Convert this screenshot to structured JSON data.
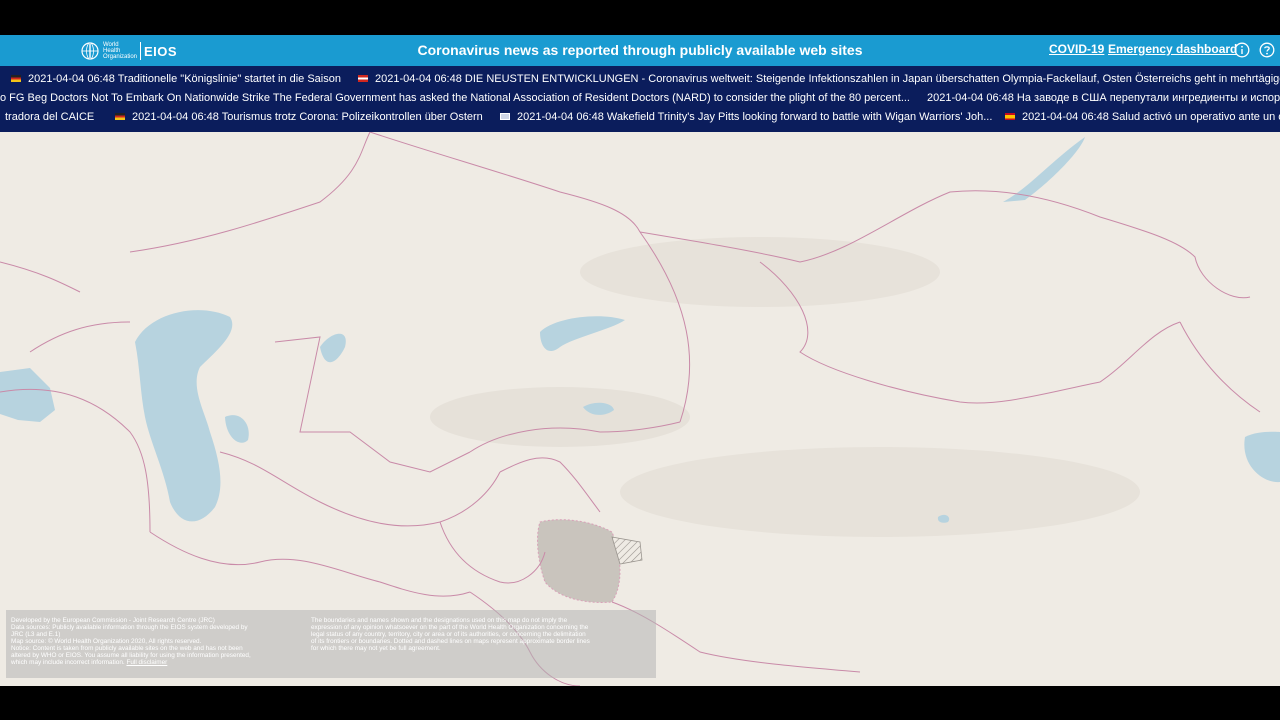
{
  "header": {
    "logo_who": "World Health Organization",
    "logo_eios": "EIOS",
    "title": "Coronavirus news as reported through publicly available web sites",
    "nav_covid": "COVID-19",
    "nav_dashboard": "Emergency dashboard",
    "icons": [
      "info-icon",
      "help-icon"
    ]
  },
  "ticker": {
    "row1": [
      {
        "flag": "de",
        "time": "2021-04-04 06:48",
        "text": "Traditionelle \"Königslinie\" startet in die Saison"
      },
      {
        "flag": "at",
        "time": "2021-04-04 06:48",
        "text": "DIE NEUSTEN ENTWICKLUNGEN - Coronavirus weltweit: Steigende Infektionszahlen in Japan überschatten Olympia-Fackellauf, Osten Österreichs geht in mehrtägigen l"
      }
    ],
    "row2": [
      {
        "flag": "",
        "time": "",
        "text": "o FG Beg Doctors Not To Embark On Nationwide Strike The Federal Government has asked the National Association of Resident Doctors (NARD) to consider the plight of the 80 percent..."
      },
      {
        "flag": "",
        "time": "2021-04-04 06:48",
        "text": "На заводе в США перепутали ингредиенты и испорт"
      }
    ],
    "row3": [
      {
        "flag": "",
        "time": "",
        "text": "tradora del CAICE"
      },
      {
        "flag": "de",
        "time": "2021-04-04 06:48",
        "text": "Tourismus trotz Corona: Polizeikontrollen über Ostern"
      },
      {
        "flag": "gb",
        "time": "2021-04-04 06:48",
        "text": "Wakefield Trinity's Jay Pitts looking forward to battle with Wigan Warriors' Joh..."
      },
      {
        "flag": "es",
        "time": "2021-04-04 06:48",
        "text": "Salud activó un operativo ante un c"
      }
    ]
  },
  "map": {
    "region": "Central Asia",
    "colors": {
      "land": "#efebe4",
      "water": "#b7d3df",
      "border": "#c98aa8",
      "disputed": "#b9b4ad"
    }
  },
  "disclaimer": {
    "left_lines": [
      "Developed by the European Commission - Joint Research Centre (JRC)",
      "Data sources: Publicly available information through the EIOS system developed by",
      "JRC (L3 and E.1)",
      "Map source: © World Health Organization 2020, All rights reserved.",
      "Notice: Content is taken from publicly available sites on the web and has not been",
      "altered by WHO or EIOS. You assume all liability for using the information presented,",
      "which may include incorrect information."
    ],
    "link": "Full disclaimer",
    "right_lines": [
      "The boundaries and names shown and the designations used on this map do not imply the",
      "expression of any opinion whatsoever on the part of the World Health Organization concerning the",
      "legal status of any country, territory, city or area or of its authorities, or concerning the delimitation",
      "of its frontiers or boundaries. Dotted and dashed lines on maps represent approximate border lines",
      "for which there may not yet be full agreement."
    ]
  }
}
